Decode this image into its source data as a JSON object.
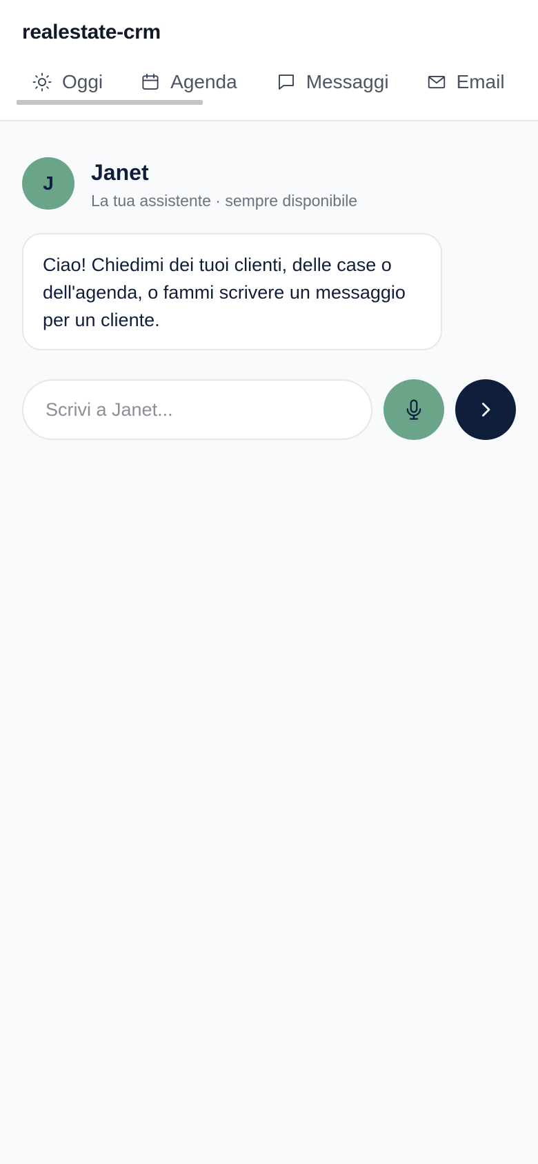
{
  "app": {
    "title": "realestate-crm"
  },
  "tabs": [
    {
      "label": "Oggi",
      "icon": "sun-icon",
      "active": true
    },
    {
      "label": "Agenda",
      "icon": "calendar-icon",
      "active": false
    },
    {
      "label": "Messaggi",
      "icon": "message-icon",
      "active": false
    },
    {
      "label": "Email",
      "icon": "mail-icon",
      "active": false
    }
  ],
  "assistant": {
    "initial": "J",
    "name": "Janet",
    "subtitle": "La tua assistente · sempre disponibile"
  },
  "messages": [
    {
      "from": "assistant",
      "text": "Ciao! Chiedimi dei tuoi clienti, delle case o dell'agenda, o fammi scrivere un messaggio per un cliente."
    }
  ],
  "composer": {
    "placeholder": "Scrivi a Janet...",
    "value": "",
    "mic_icon": "microphone-icon",
    "send_icon": "chevron-right-icon"
  },
  "colors": {
    "accent_green": "#6aa58a",
    "navy": "#0f1e3a",
    "background": "#f8fafc",
    "tab_indicator": "#c4c4c4"
  }
}
